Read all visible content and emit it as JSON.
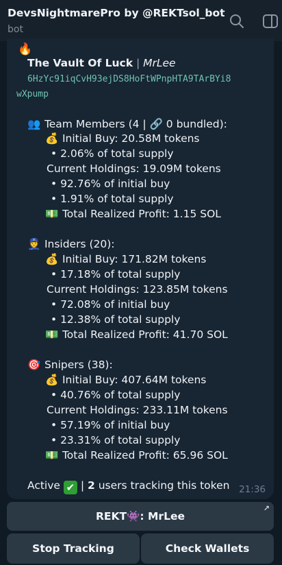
{
  "header": {
    "title": "DevsNightmarePro by @REKTsol_bot",
    "subtitle": "bot"
  },
  "message": {
    "flame": "🔥",
    "token_name": "The Vault Of Luck",
    "separator": "|",
    "dev_name": "MrLee",
    "address_line1": "6HzYc91iqCvH93ejDS8HoFtWPnpHTA9TArBYi8",
    "address_line2": "wXpump",
    "team": {
      "icon": "👥",
      "heading": "Team Members (4 | 🔗 0 bundled):",
      "initial_buy_icon": "💰",
      "initial_buy": "Initial Buy: 20.58M tokens",
      "initial_supply": "• 2.06% of total supply",
      "holdings": "Current Holdings: 19.09M tokens",
      "holdings_pct_initial": "• 92.76% of initial buy",
      "holdings_pct_supply": "• 1.91% of total supply",
      "profit_icon": "💵",
      "profit": "Total Realized Profit: 1.15 SOL"
    },
    "insiders": {
      "icon": "👮",
      "heading": "Insiders (20):",
      "initial_buy_icon": "💰",
      "initial_buy": "Initial Buy: 171.82M tokens",
      "initial_supply": "• 17.18% of total supply",
      "holdings": "Current Holdings: 123.85M tokens",
      "holdings_pct_initial": "• 72.08% of initial buy",
      "holdings_pct_supply": "• 12.38% of total supply",
      "profit_icon": "💵",
      "profit": "Total Realized Profit: 41.70 SOL"
    },
    "snipers": {
      "icon": "🎯",
      "heading": "Snipers (38):",
      "initial_buy_icon": "💰",
      "initial_buy": "Initial Buy: 407.64M tokens",
      "initial_supply": "• 40.76% of total supply",
      "holdings": "Current Holdings: 233.11M tokens",
      "holdings_pct_initial": "• 57.19% of initial buy",
      "holdings_pct_supply": "• 23.31% of total supply",
      "profit_icon": "💵",
      "profit": "Total Realized Profit: 65.96 SOL"
    },
    "status_prefix": "Active",
    "status_check": "✔",
    "status_sep": "|",
    "users_count": "2",
    "users_suffix": "users tracking this token",
    "time": "21:36"
  },
  "keyboard": {
    "link_button": "REKT👾: MrLee",
    "link_arrow": "↗",
    "stop_button": "Stop Tracking",
    "check_button": "Check Wallets"
  },
  "icons": {
    "search": "search-icon",
    "panel": "sidebar-panel-icon",
    "accent": "#6fc3b2",
    "bubble_bg": "#182533",
    "button_bg": "#2b3945"
  }
}
